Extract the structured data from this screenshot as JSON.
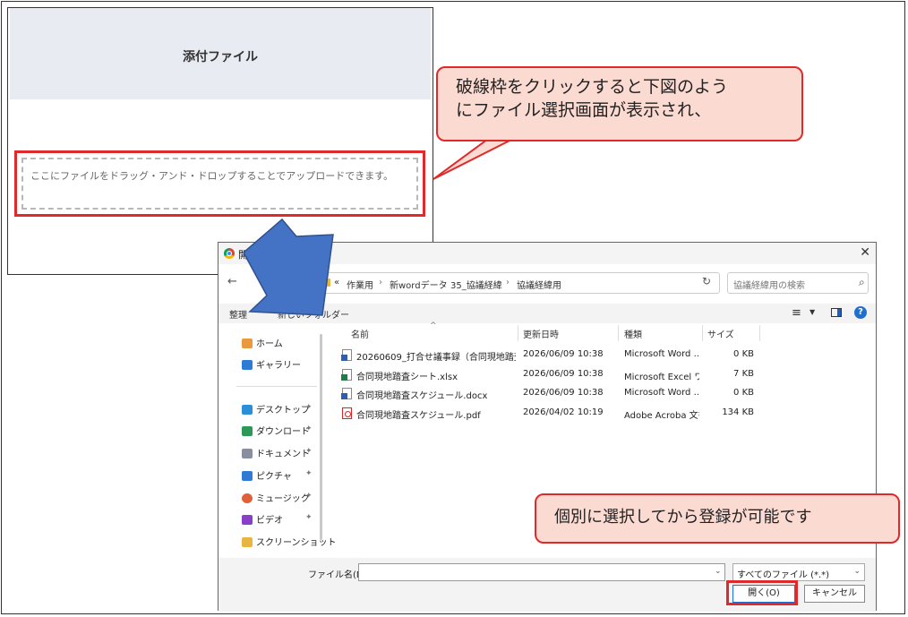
{
  "upload_panel": {
    "title": "添付ファイル",
    "drop_zone_text": "ここにファイルをドラッグ・アンド・ドロップすることでアップロードできます。"
  },
  "callouts": {
    "top_line1": "破線枠をクリックすると下図のよう",
    "top_line2": "にファイル選択画面が表示され、",
    "bottom": "個別に選択してから登録が可能です"
  },
  "dialog": {
    "title": "開く",
    "close_glyph": "✕",
    "back_glyph": "←",
    "breadcrumb": [
      "«",
      "作業用",
      "新wordデータ",
      "35_協議経緯",
      "協議経緯用"
    ],
    "breadcrumb_sep": "›",
    "search_placeholder": "協議経緯用の検索",
    "toolbar": {
      "organize": "整理",
      "new_folder": "新しいフォルダー"
    },
    "sidebar": {
      "items": [
        {
          "label": "ホーム"
        },
        {
          "label": "ギャラリー"
        },
        {
          "label": "デスクトップ"
        },
        {
          "label": "ダウンロード"
        },
        {
          "label": "ドキュメント"
        },
        {
          "label": "ピクチャ"
        },
        {
          "label": "ミュージック"
        },
        {
          "label": "ビデオ"
        },
        {
          "label": "スクリーンショット"
        }
      ],
      "pin_glyph": "📌"
    },
    "columns": {
      "name": "名前",
      "modified": "更新日時",
      "type": "種類",
      "size": "サイズ"
    },
    "files": [
      {
        "name": "20260609_打合せ議事録（合同現地踏査...",
        "modified": "2026/06/09 10:38",
        "type": "Microsoft Word ...",
        "size": "0 KB",
        "kind": "word"
      },
      {
        "name": "合同現地踏査シート.xlsx",
        "modified": "2026/06/09 10:38",
        "type": "Microsoft Excel ワ...",
        "size": "7 KB",
        "kind": "excel"
      },
      {
        "name": "合同現地踏査スケジュール.docx",
        "modified": "2026/06/09 10:38",
        "type": "Microsoft Word ...",
        "size": "0 KB",
        "kind": "word"
      },
      {
        "name": "合同現地踏査スケジュール.pdf",
        "modified": "2026/04/02 10:19",
        "type": "Adobe Acroba 文書",
        "size": "134 KB",
        "kind": "pdf"
      }
    ],
    "filename_label": "ファイル名(N):",
    "filename_value": "",
    "filter_value": "すべてのファイル (*.*)",
    "open_label": "開く(O)",
    "cancel_label": "キャンセル",
    "help_glyph": "?"
  },
  "colors": {
    "highlight": "#e0292a",
    "callout_fill": "#fbdad2",
    "arrow_fill": "#4472c4"
  }
}
